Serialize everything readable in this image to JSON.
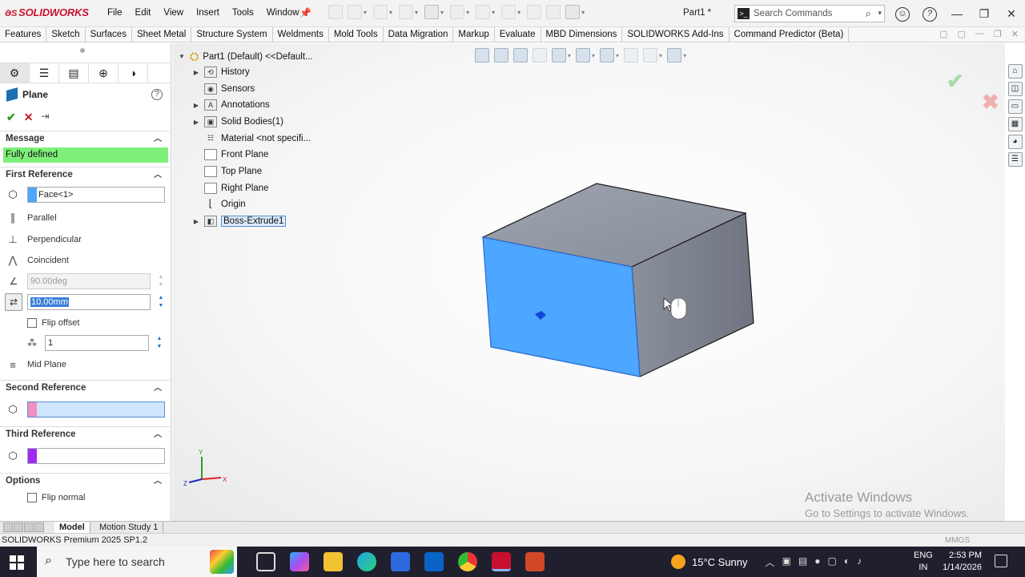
{
  "app": {
    "brand": "SOLIDWORKS",
    "menus": [
      "File",
      "Edit",
      "View",
      "Insert",
      "Tools",
      "Window"
    ],
    "document_title": "Part1 *",
    "search_placeholder": "Search Commands"
  },
  "command_tabs": [
    "Features",
    "Sketch",
    "Surfaces",
    "Sheet Metal",
    "Structure System",
    "Weldments",
    "Mold Tools",
    "Data Migration",
    "Markup",
    "Evaluate",
    "MBD Dimensions",
    "SOLIDWORKS Add-Ins",
    "Command Predictor (Beta)"
  ],
  "property_manager": {
    "title": "Plane",
    "message_header": "Message",
    "message": "Fully defined",
    "first_reference": {
      "header": "First Reference",
      "selection": "Face<1>",
      "swatch_color": "#4da6ff",
      "constraints": [
        "Parallel",
        "Perpendicular",
        "Coincident"
      ],
      "angle_value": "90.00deg",
      "offset_value": "10.00mm",
      "flip_offset_label": "Flip offset",
      "instances_value": "1",
      "mid_plane_label": "Mid Plane"
    },
    "second_reference": {
      "header": "Second Reference",
      "selection": "",
      "swatch_color": "#f08fc0"
    },
    "third_reference": {
      "header": "Third Reference",
      "selection": "",
      "swatch_color": "#9b2cf0"
    },
    "options": {
      "header": "Options",
      "flip_normal_label": "Flip normal"
    }
  },
  "feature_tree": {
    "root": "Part1 (Default) <<Default...",
    "items": [
      {
        "label": "History",
        "expandable": true,
        "icon": "history-icon"
      },
      {
        "label": "Sensors",
        "expandable": false,
        "icon": "sensor-icon"
      },
      {
        "label": "Annotations",
        "expandable": true,
        "icon": "annotation-icon"
      },
      {
        "label": "Solid Bodies(1)",
        "expandable": true,
        "icon": "solid-bodies-icon"
      },
      {
        "label": "Material <not specifi...",
        "expandable": false,
        "icon": "material-icon"
      },
      {
        "label": "Front Plane",
        "expandable": false,
        "icon": "plane-icon"
      },
      {
        "label": "Top Plane",
        "expandable": false,
        "icon": "plane-icon"
      },
      {
        "label": "Right Plane",
        "expandable": false,
        "icon": "plane-icon"
      },
      {
        "label": "Origin",
        "expandable": false,
        "icon": "origin-icon"
      },
      {
        "label": "Boss-Extrude1",
        "expandable": true,
        "icon": "extrude-icon",
        "selected": true
      }
    ]
  },
  "bottom_tabs": [
    "Model",
    "Motion Study 1"
  ],
  "status": {
    "product": "SOLIDWORKS Premium 2025 SP1.2",
    "units": "MMGS"
  },
  "watermark": {
    "line1": "Activate Windows",
    "line2": "Go to Settings to activate Windows."
  },
  "taskbar": {
    "search_placeholder": "Type here to search",
    "weather": "15°C  Sunny",
    "language_line1": "ENG",
    "language_line2": "IN",
    "time": "2:53 PM",
    "date": "1/14/2026"
  },
  "colors": {
    "selected_face": "#4da6ff",
    "part_face": "#8f94a1",
    "message_bg": "#7ef07a"
  }
}
